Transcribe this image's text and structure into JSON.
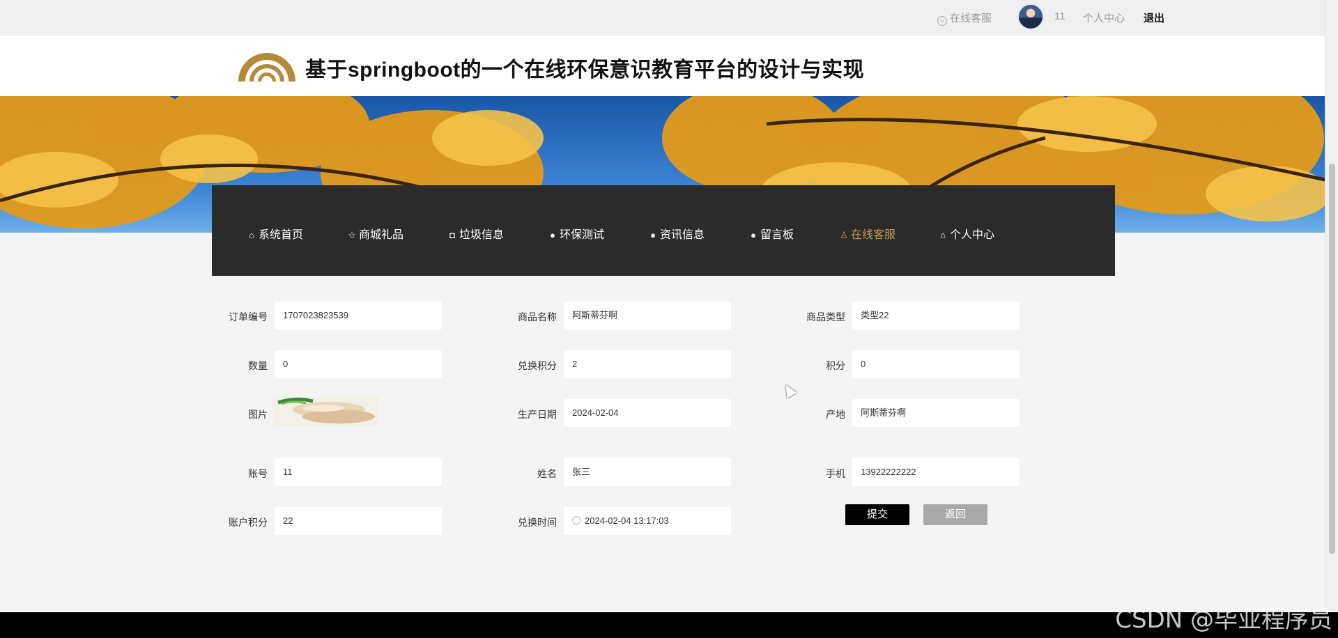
{
  "topbar": {
    "customer_service": "在线客服",
    "user_id": "11",
    "personal_center": "个人中心",
    "logout": "退出"
  },
  "header": {
    "title": "基于springboot的一个在线环保意识教育平台的设计与实现"
  },
  "nav": {
    "items": [
      {
        "label": "系统首页",
        "icon": "home-icon"
      },
      {
        "label": "商城礼品",
        "icon": "star-icon"
      },
      {
        "label": "垃圾信息",
        "icon": "bag-icon"
      },
      {
        "label": "环保测试",
        "icon": "alert-icon"
      },
      {
        "label": "资讯信息",
        "icon": "question-icon"
      },
      {
        "label": "留言板",
        "icon": "info-icon"
      },
      {
        "label": "在线客服",
        "icon": "user-icon",
        "active": true
      },
      {
        "label": "个人中心",
        "icon": "home-icon"
      }
    ],
    "active_color": "#c39a52"
  },
  "form": {
    "order_no": {
      "label": "订单编号",
      "value": "1707023823539"
    },
    "product_name": {
      "label": "商品名称",
      "value": "阿斯蒂芬啊"
    },
    "product_type": {
      "label": "商品类型",
      "value": "类型22"
    },
    "quantity": {
      "label": "数量",
      "value": "0"
    },
    "exchange_points": {
      "label": "兑换积分",
      "value": "2"
    },
    "points": {
      "label": "积分",
      "value": "0"
    },
    "image": {
      "label": "图片"
    },
    "production_date": {
      "label": "生产日期",
      "value": "2024-02-04"
    },
    "origin": {
      "label": "产地",
      "value": "阿斯蒂芬啊"
    },
    "account": {
      "label": "账号",
      "value": "11"
    },
    "name": {
      "label": "姓名",
      "value": "张三"
    },
    "phone": {
      "label": "手机",
      "value": "13922222222"
    },
    "account_points": {
      "label": "账户积分",
      "value": "22"
    },
    "exchange_time": {
      "label": "兑换时间",
      "value": "2024-02-04 13:17:03"
    }
  },
  "buttons": {
    "submit": "提交",
    "back": "返回"
  },
  "watermark": "CSDN @毕业程序员"
}
